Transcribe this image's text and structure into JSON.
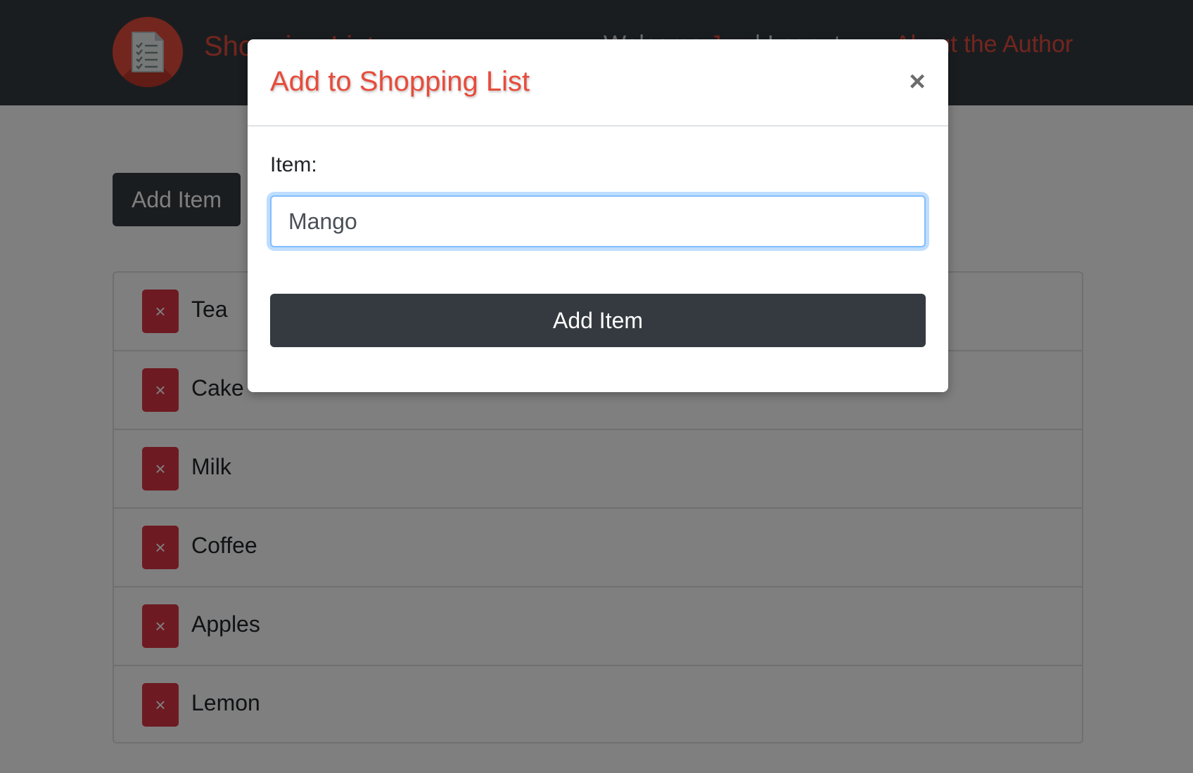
{
  "navbar": {
    "brand": "Shopping List",
    "welcome_prefix": "Welcome ",
    "welcome_user": "Joe",
    "welcome_suffix": " | Logout",
    "about_link": "About the Author",
    "logo_icon": "checklist-document-icon"
  },
  "main": {
    "add_button_label": "Add Item",
    "items": [
      {
        "label": "Tea"
      },
      {
        "label": "Cake"
      },
      {
        "label": "Milk"
      },
      {
        "label": "Coffee"
      },
      {
        "label": "Apples"
      },
      {
        "label": "Lemon"
      }
    ],
    "delete_icon": "×"
  },
  "modal": {
    "title": "Add to Shopping List",
    "close_icon": "×",
    "field_label": "Item:",
    "field_value": "Mango",
    "submit_label": "Add Item"
  },
  "colors": {
    "accent": "#e74c3c",
    "navbar_bg": "#343a40",
    "danger": "#dc3545",
    "dark_button": "#343a40"
  }
}
